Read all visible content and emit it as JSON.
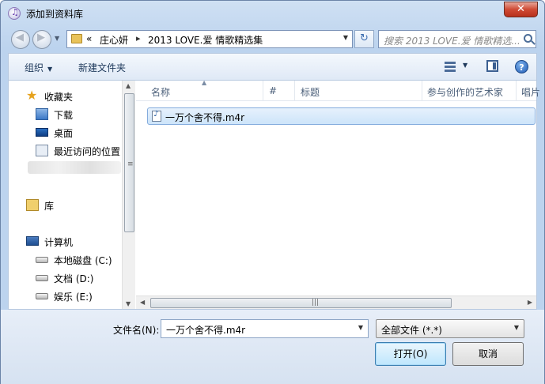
{
  "window": {
    "title": "添加到资料库",
    "close_label": "✕"
  },
  "navigation": {
    "back_glyph": "◀",
    "forward_glyph": "▶",
    "breadcrumb_prefix": "«",
    "breadcrumbs": [
      "庄心妍",
      "2013 LOVE.爱 情歌精选集"
    ],
    "breadcrumb_separator": "▸",
    "refresh_glyph": "↻",
    "search_placeholder": "搜索 2013 LOVE.爱 情歌精选..."
  },
  "toolbar": {
    "organize_label": "组织",
    "new_folder_label": "新建文件夹",
    "help_label": "?"
  },
  "sidebar": {
    "favorites_label": "收藏夹",
    "favorites": [
      {
        "label": "下载",
        "icon": "download-folder-icon"
      },
      {
        "label": "桌面",
        "icon": "desktop-icon"
      },
      {
        "label": "最近访问的位置",
        "icon": "recent-places-icon"
      }
    ],
    "libraries_label": "库",
    "computer_label": "计算机",
    "drives": [
      {
        "label": "本地磁盘 (C:)"
      },
      {
        "label": "文档 (D:)"
      },
      {
        "label": "娱乐 (E:)"
      }
    ]
  },
  "file_list": {
    "columns": [
      "名称",
      "#",
      "标题",
      "参与创作的艺术家",
      "唱片"
    ],
    "files": [
      {
        "name": "一万个舍不得.m4r",
        "selected": true
      }
    ]
  },
  "bottom": {
    "filename_label": "文件名(N):",
    "filename_value": "一万个舍不得.m4r",
    "filter_value": "全部文件 (*.*)",
    "open_label": "打开(O)",
    "cancel_label": "取消"
  },
  "colors": {
    "accent": "#3c7fb1",
    "selection": "#cde4fa",
    "close_red": "#cf4a34"
  }
}
